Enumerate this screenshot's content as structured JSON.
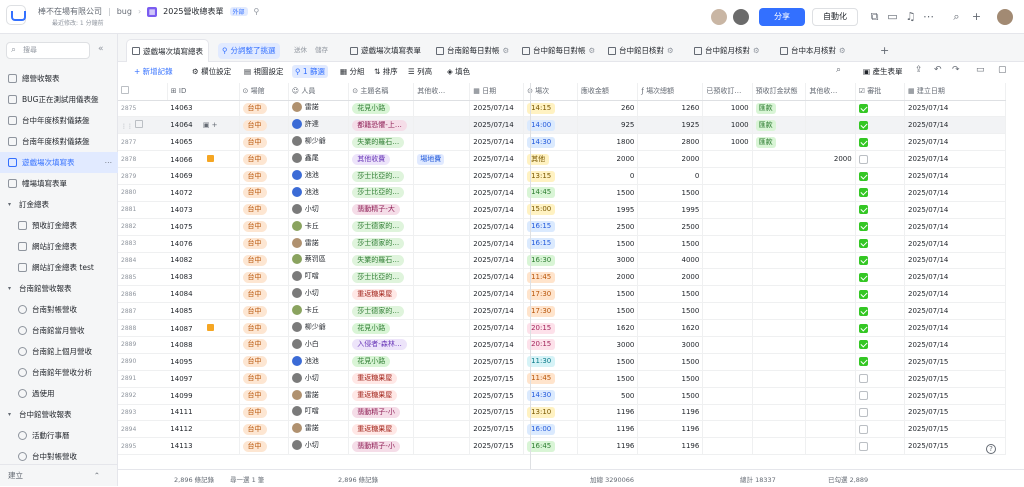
{
  "header": {
    "breadcrumb": [
      "棒不在場有限公司",
      "bug",
      "2025營收總表單"
    ],
    "doc_badge": "外部",
    "subtitle": "最近修改: 1 分鐘前",
    "share_label": "分享",
    "automation_label": "自動化"
  },
  "sidebar": {
    "search_placeholder": "搜尋",
    "items": [
      {
        "label": "總營收報表",
        "kind": "table",
        "level": 0
      },
      {
        "label": "BUG正在測試用儀表盤",
        "kind": "table",
        "level": 0
      },
      {
        "label": "台中年度核對儀錶盤",
        "kind": "table",
        "level": 0
      },
      {
        "label": "台南年度核對儀錶盤",
        "kind": "table",
        "level": 0
      },
      {
        "label": "遊戲場次填寫表",
        "kind": "table",
        "level": 0,
        "active": true
      },
      {
        "label": "幢場填寫表單",
        "kind": "table",
        "level": 0
      },
      {
        "label": "訂金總表",
        "kind": "folder",
        "level": 0
      },
      {
        "label": "預收訂金總表",
        "kind": "table",
        "level": 1
      },
      {
        "label": "網站訂金總表",
        "kind": "table",
        "level": 1
      },
      {
        "label": "網站訂金總表 test",
        "kind": "table",
        "level": 1
      },
      {
        "label": "台南館營收報表",
        "kind": "folder",
        "level": 0
      },
      {
        "label": "台南對帳營收",
        "kind": "dash",
        "level": 1
      },
      {
        "label": "台南館當月營收",
        "kind": "dash",
        "level": 1
      },
      {
        "label": "台南館上個月營收",
        "kind": "dash",
        "level": 1
      },
      {
        "label": "台南館年營收分析",
        "kind": "dash",
        "level": 1
      },
      {
        "label": "過使用",
        "kind": "dash",
        "level": 1
      },
      {
        "label": "台中館營收報表",
        "kind": "folder",
        "level": 0
      },
      {
        "label": "活動行事曆",
        "kind": "dash",
        "level": 1
      },
      {
        "label": "台中對帳營收",
        "kind": "dash",
        "level": 1
      }
    ],
    "bottom_label": "建立"
  },
  "tabs": [
    {
      "label": "遊戲場次填寫總表",
      "active": true
    },
    {
      "label": "分詞整了挑選",
      "highlight": true
    },
    {
      "label": "送休"
    },
    {
      "label": "儲存"
    },
    {
      "label": "遊戲場次填寫表單"
    },
    {
      "label": "台南館每日對帳"
    },
    {
      "label": "台中館每日對帳"
    },
    {
      "label": "台中館日核對"
    },
    {
      "label": "台中館月核對"
    },
    {
      "label": "台中本月核對"
    }
  ],
  "toolbar": {
    "add_record": "+ 新增記錄",
    "field_settings": "欄位設定",
    "view_settings": "視圖設定",
    "filter": "1 篩選",
    "group": "分組",
    "sort": "排序",
    "row_height": "列高",
    "fill_color": "填色",
    "generate_form": "產生表單"
  },
  "columns": [
    "ID",
    "場館",
    "人員",
    "主題名稱",
    "其他收…",
    "日期",
    "場次",
    "應收金額",
    "場次總額",
    "已預收訂…",
    "預收訂金狀態",
    "其他收…",
    "審批",
    "建立日期"
  ],
  "rows": [
    {
      "n": "2875",
      "id": "14063",
      "venue": "台中",
      "person": "雷諾",
      "pc": "l",
      "theme": "花見小路",
      "tc": "c-flower",
      "other": "",
      "date": "2025/07/14",
      "slot": "14:15",
      "sc": "t-y",
      "due": "260",
      "total": "1260",
      "pre": "1000",
      "st": "匯款",
      "stc": "hk",
      "oth2": "",
      "ok": true,
      "created": "2025/07/14"
    },
    {
      "n": "",
      "id": "14064",
      "venue": "台中",
      "person": "許達",
      "pc": "bl",
      "theme": "都籍恐懼-上…",
      "tc": "c-wine",
      "other": "",
      "date": "2025/07/14",
      "slot": "14:00",
      "sc": "t-b",
      "due": "925",
      "total": "1925",
      "pre": "1000",
      "st": "匯款",
      "stc": "hk",
      "oth2": "",
      "ok": true,
      "created": "2025/07/14",
      "hover": true
    },
    {
      "n": "2877",
      "id": "14065",
      "venue": "台中",
      "person": "柳少爺",
      "pc": "",
      "theme": "失業的羅石…",
      "tc": "c-sand",
      "other": "",
      "date": "2025/07/14",
      "slot": "14:30",
      "sc": "t-b",
      "due": "1800",
      "total": "2800",
      "pre": "1000",
      "st": "匯款",
      "stc": "hk",
      "oth2": "",
      "ok": true,
      "created": "2025/07/14"
    },
    {
      "n": "2878",
      "id": "14066",
      "venue": "台中",
      "person": "鑫尾",
      "pc": "",
      "theme": "其他收費",
      "tc": "c-other",
      "other": "場地費",
      "date": "2025/07/14",
      "slot": "其他",
      "sc": "t-y",
      "due": "2000",
      "total": "2000",
      "pre": "",
      "st": "",
      "stc": "",
      "oth2": "2000",
      "ok": false,
      "created": "2025/07/14",
      "flag": true
    },
    {
      "n": "2879",
      "id": "14069",
      "venue": "台中",
      "person": "池池",
      "pc": "bl",
      "theme": "莎士比亞的…",
      "tc": "c-sand",
      "other": "",
      "date": "2025/07/14",
      "slot": "13:15",
      "sc": "t-y",
      "due": "0",
      "total": "0",
      "pre": "",
      "st": "",
      "stc": "",
      "oth2": "",
      "ok": true,
      "created": "2025/07/14"
    },
    {
      "n": "2880",
      "id": "14072",
      "venue": "台中",
      "person": "池池",
      "pc": "bl",
      "theme": "莎士比亞的…",
      "tc": "c-sand",
      "other": "",
      "date": "2025/07/14",
      "slot": "14:45",
      "sc": "t-g",
      "due": "1500",
      "total": "1500",
      "pre": "",
      "st": "",
      "stc": "",
      "oth2": "",
      "ok": true,
      "created": "2025/07/14"
    },
    {
      "n": "2881",
      "id": "14073",
      "venue": "台中",
      "person": "小切",
      "pc": "",
      "theme": "翡動精子-大",
      "tc": "c-wine",
      "other": "",
      "date": "2025/07/14",
      "slot": "15:00",
      "sc": "t-y",
      "due": "1995",
      "total": "1995",
      "pre": "",
      "st": "",
      "stc": "",
      "oth2": "",
      "ok": true,
      "created": "2025/07/14"
    },
    {
      "n": "2882",
      "id": "14075",
      "venue": "台中",
      "person": "卡丘",
      "pc": "g",
      "theme": "莎士德家的…",
      "tc": "c-sand",
      "other": "",
      "date": "2025/07/14",
      "slot": "16:15",
      "sc": "t-b",
      "due": "2500",
      "total": "2500",
      "pre": "",
      "st": "",
      "stc": "",
      "oth2": "",
      "ok": true,
      "created": "2025/07/14"
    },
    {
      "n": "2883",
      "id": "14076",
      "venue": "台中",
      "person": "雷諾",
      "pc": "l",
      "theme": "莎士德家的…",
      "tc": "c-sand",
      "other": "",
      "date": "2025/07/14",
      "slot": "16:15",
      "sc": "t-b",
      "due": "1500",
      "total": "1500",
      "pre": "",
      "st": "",
      "stc": "",
      "oth2": "",
      "ok": true,
      "created": "2025/07/14"
    },
    {
      "n": "2884",
      "id": "14082",
      "venue": "台中",
      "person": "蔡罚區",
      "pc": "g",
      "theme": "失業的羅石…",
      "tc": "c-sand",
      "other": "",
      "date": "2025/07/14",
      "slot": "16:30",
      "sc": "t-g",
      "due": "3000",
      "total": "4000",
      "pre": "",
      "st": "",
      "stc": "",
      "oth2": "",
      "ok": true,
      "created": "2025/07/14"
    },
    {
      "n": "2885",
      "id": "14083",
      "venue": "台中",
      "person": "叮噹",
      "pc": "",
      "theme": "莎士比亞的…",
      "tc": "c-sand",
      "other": "",
      "date": "2025/07/14",
      "slot": "11:45",
      "sc": "t-o",
      "due": "2000",
      "total": "2000",
      "pre": "",
      "st": "",
      "stc": "",
      "oth2": "",
      "ok": true,
      "created": "2025/07/14"
    },
    {
      "n": "2886",
      "id": "14084",
      "venue": "台中",
      "person": "小切",
      "pc": "",
      "theme": "重返糖果屋",
      "tc": "c-earth",
      "other": "",
      "date": "2025/07/14",
      "slot": "17:30",
      "sc": "t-o",
      "due": "1500",
      "total": "1500",
      "pre": "",
      "st": "",
      "stc": "",
      "oth2": "",
      "ok": true,
      "created": "2025/07/14"
    },
    {
      "n": "2887",
      "id": "14085",
      "venue": "台中",
      "person": "卡丘",
      "pc": "g",
      "theme": "莎士德家的…",
      "tc": "c-sand",
      "other": "",
      "date": "2025/07/14",
      "slot": "17:30",
      "sc": "t-o",
      "due": "1500",
      "total": "1500",
      "pre": "",
      "st": "",
      "stc": "",
      "oth2": "",
      "ok": true,
      "created": "2025/07/14"
    },
    {
      "n": "2888",
      "id": "14087",
      "venue": "台中",
      "person": "柳少爺",
      "pc": "",
      "theme": "花見小路",
      "tc": "c-flower",
      "other": "",
      "date": "2025/07/14",
      "slot": "20:15",
      "sc": "t-p",
      "due": "1620",
      "total": "1620",
      "pre": "",
      "st": "",
      "stc": "",
      "oth2": "",
      "ok": true,
      "created": "2025/07/14",
      "flag": true
    },
    {
      "n": "2889",
      "id": "14088",
      "venue": "台中",
      "person": "小白",
      "pc": "",
      "theme": "入侵者-森林…",
      "tc": "c-other",
      "other": "",
      "date": "2025/07/14",
      "slot": "20:15",
      "sc": "t-p",
      "due": "3000",
      "total": "3000",
      "pre": "",
      "st": "",
      "stc": "",
      "oth2": "",
      "ok": true,
      "created": "2025/07/14"
    },
    {
      "n": "2890",
      "id": "14095",
      "venue": "台中",
      "person": "池池",
      "pc": "bl",
      "theme": "花見小路",
      "tc": "c-flower",
      "other": "",
      "date": "2025/07/15",
      "slot": "11:30",
      "sc": "t-c",
      "due": "1500",
      "total": "1500",
      "pre": "",
      "st": "",
      "stc": "",
      "oth2": "",
      "ok": true,
      "created": "2025/07/15"
    },
    {
      "n": "2891",
      "id": "14097",
      "venue": "台中",
      "person": "小切",
      "pc": "",
      "theme": "重返糖果屋",
      "tc": "c-earth",
      "other": "",
      "date": "2025/07/15",
      "slot": "11:45",
      "sc": "t-o",
      "due": "1500",
      "total": "1500",
      "pre": "",
      "st": "",
      "stc": "",
      "oth2": "",
      "ok": false,
      "created": "2025/07/15"
    },
    {
      "n": "2892",
      "id": "14099",
      "venue": "台中",
      "person": "雷諾",
      "pc": "l",
      "theme": "重返糖果屋",
      "tc": "c-earth",
      "other": "",
      "date": "2025/07/15",
      "slot": "14:30",
      "sc": "t-b",
      "due": "500",
      "total": "1500",
      "pre": "",
      "st": "",
      "stc": "",
      "oth2": "",
      "ok": false,
      "created": "2025/07/15"
    },
    {
      "n": "2893",
      "id": "14111",
      "venue": "台中",
      "person": "叮噹",
      "pc": "",
      "theme": "翡動精子-小",
      "tc": "c-wine",
      "other": "",
      "date": "2025/07/15",
      "slot": "13:10",
      "sc": "t-y",
      "due": "1196",
      "total": "1196",
      "pre": "",
      "st": "",
      "stc": "",
      "oth2": "",
      "ok": false,
      "created": "2025/07/15"
    },
    {
      "n": "2894",
      "id": "14112",
      "venue": "台中",
      "person": "雷諾",
      "pc": "l",
      "theme": "重返糖果屋",
      "tc": "c-earth",
      "other": "",
      "date": "2025/07/15",
      "slot": "16:00",
      "sc": "t-b",
      "due": "1196",
      "total": "1196",
      "pre": "",
      "st": "",
      "stc": "",
      "oth2": "",
      "ok": false,
      "created": "2025/07/15"
    },
    {
      "n": "2895",
      "id": "14113",
      "venue": "台中",
      "person": "小切",
      "pc": "",
      "theme": "翡動精子-小",
      "tc": "c-wine",
      "other": "",
      "date": "2025/07/15",
      "slot": "16:45",
      "sc": "t-g",
      "due": "1196",
      "total": "1196",
      "pre": "",
      "st": "",
      "stc": "",
      "oth2": "",
      "ok": false,
      "created": "2025/07/15"
    }
  ],
  "status": {
    "records_left": "2,896 條記錄",
    "sum_label": "尋一選 1 筆",
    "records_right": "2,896 條記錄",
    "total_due": "加總 3290066",
    "total_sum": "總計 18337",
    "approved": "已勾選 2,889"
  },
  "colors": {
    "accent": "#3370ff",
    "check": "#34c724"
  }
}
